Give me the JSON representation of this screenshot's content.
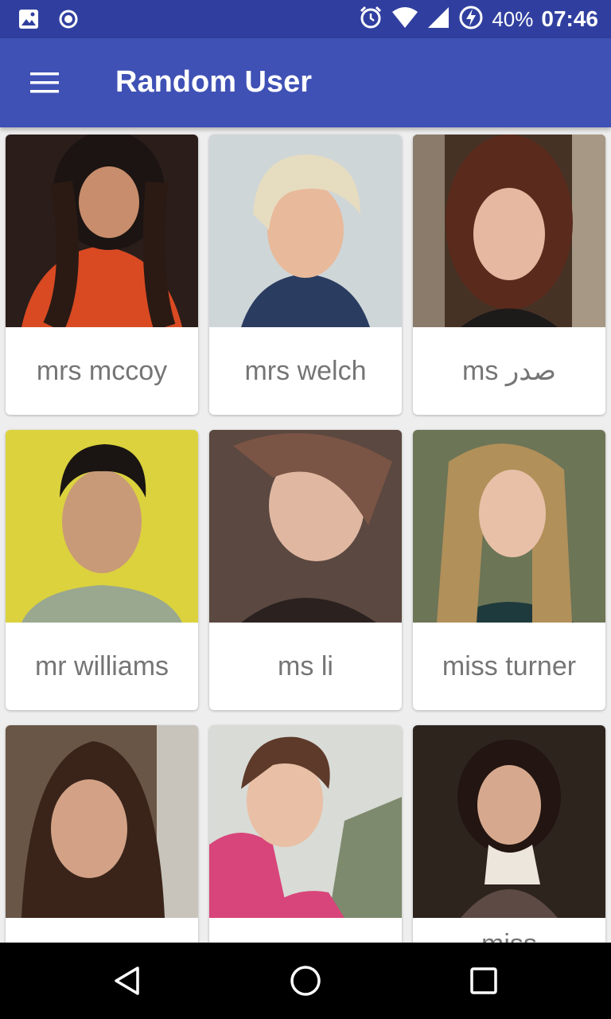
{
  "status_bar": {
    "battery": "40%",
    "time": "07:46",
    "icons": [
      "image-icon",
      "record-icon",
      "alarm-icon",
      "wifi-icon",
      "signal-icon",
      "battery-charging-icon"
    ]
  },
  "app_bar": {
    "title": "Random User",
    "menu_icon": "hamburger-menu-icon"
  },
  "users": [
    {
      "name": "mrs mccoy",
      "photo_bg": "#6b2a1c"
    },
    {
      "name": "mrs welch",
      "photo_bg": "#c9d2d6"
    },
    {
      "name": "ms صدر",
      "photo_bg": "#5a3a2a"
    },
    {
      "name": "mr williams",
      "photo_bg": "#d8cc3a"
    },
    {
      "name": "ms li",
      "photo_bg": "#6a5048"
    },
    {
      "name": "miss turner",
      "photo_bg": "#6f7858"
    },
    {
      "name": "",
      "photo_bg": "#4a3428"
    },
    {
      "name": "",
      "photo_bg": "#b9b6b0"
    },
    {
      "name": "miss",
      "photo_bg": "#2e241e"
    }
  ],
  "nav_bar": {
    "back_icon": "back-triangle-icon",
    "home_icon": "home-circle-icon",
    "recents_icon": "recents-square-icon"
  }
}
